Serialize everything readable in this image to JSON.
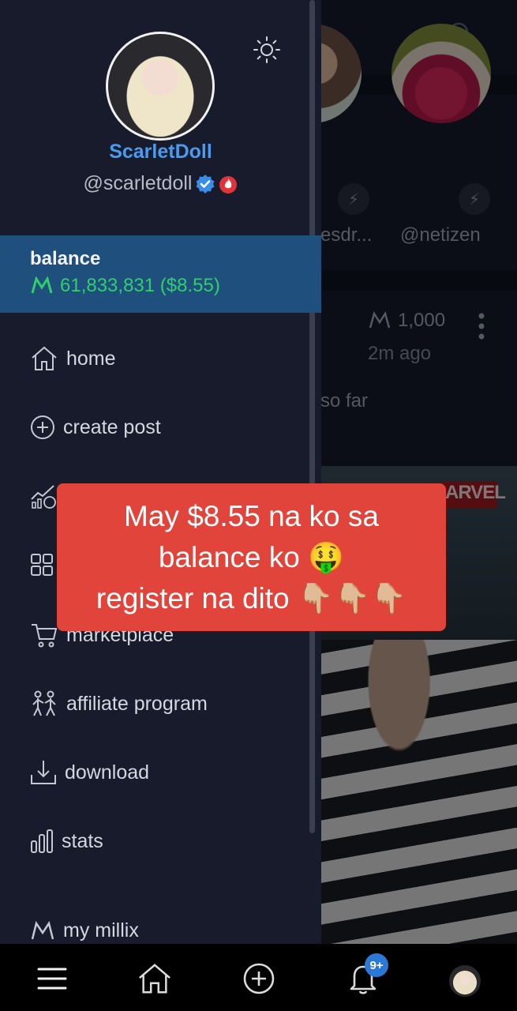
{
  "feed": {
    "stories": [
      {
        "name": "esdr..."
      },
      {
        "name": "@netizen"
      }
    ],
    "post": {
      "coin_amount": "1,000",
      "time": "2m ago",
      "text_fragment": "so far",
      "comic_logo": "ARVEL"
    }
  },
  "profile": {
    "display_name": "ScarletDoll",
    "handle": "@scarletdoll"
  },
  "balance": {
    "label": "balance",
    "value": "61,833,831 ($8.55)"
  },
  "menu": {
    "items": [
      {
        "label": "home",
        "icon": "home-icon"
      },
      {
        "label": "create post",
        "icon": "plus-circle-icon"
      },
      {
        "label": "marketplace",
        "icon": "cart-icon"
      },
      {
        "label": "affiliate program",
        "icon": "people-icon"
      },
      {
        "label": "download",
        "icon": "download-icon"
      },
      {
        "label": "stats",
        "icon": "bar-chart-icon"
      },
      {
        "label": "my millix",
        "icon": "millix-icon"
      }
    ]
  },
  "caption": {
    "lines": [
      "May $8.55 na ko sa",
      "balance ko 🤑",
      "register na dito 👇🏼👇🏼👇🏼"
    ]
  },
  "bottom_nav": {
    "notification_badge": "9+"
  },
  "colors": {
    "drawer_bg": "#171b2c",
    "balance_bg": "#1e4f7d",
    "balance_green": "#2fd06a",
    "name_blue": "#4a9bf0",
    "caption_red": "#e1443b"
  }
}
